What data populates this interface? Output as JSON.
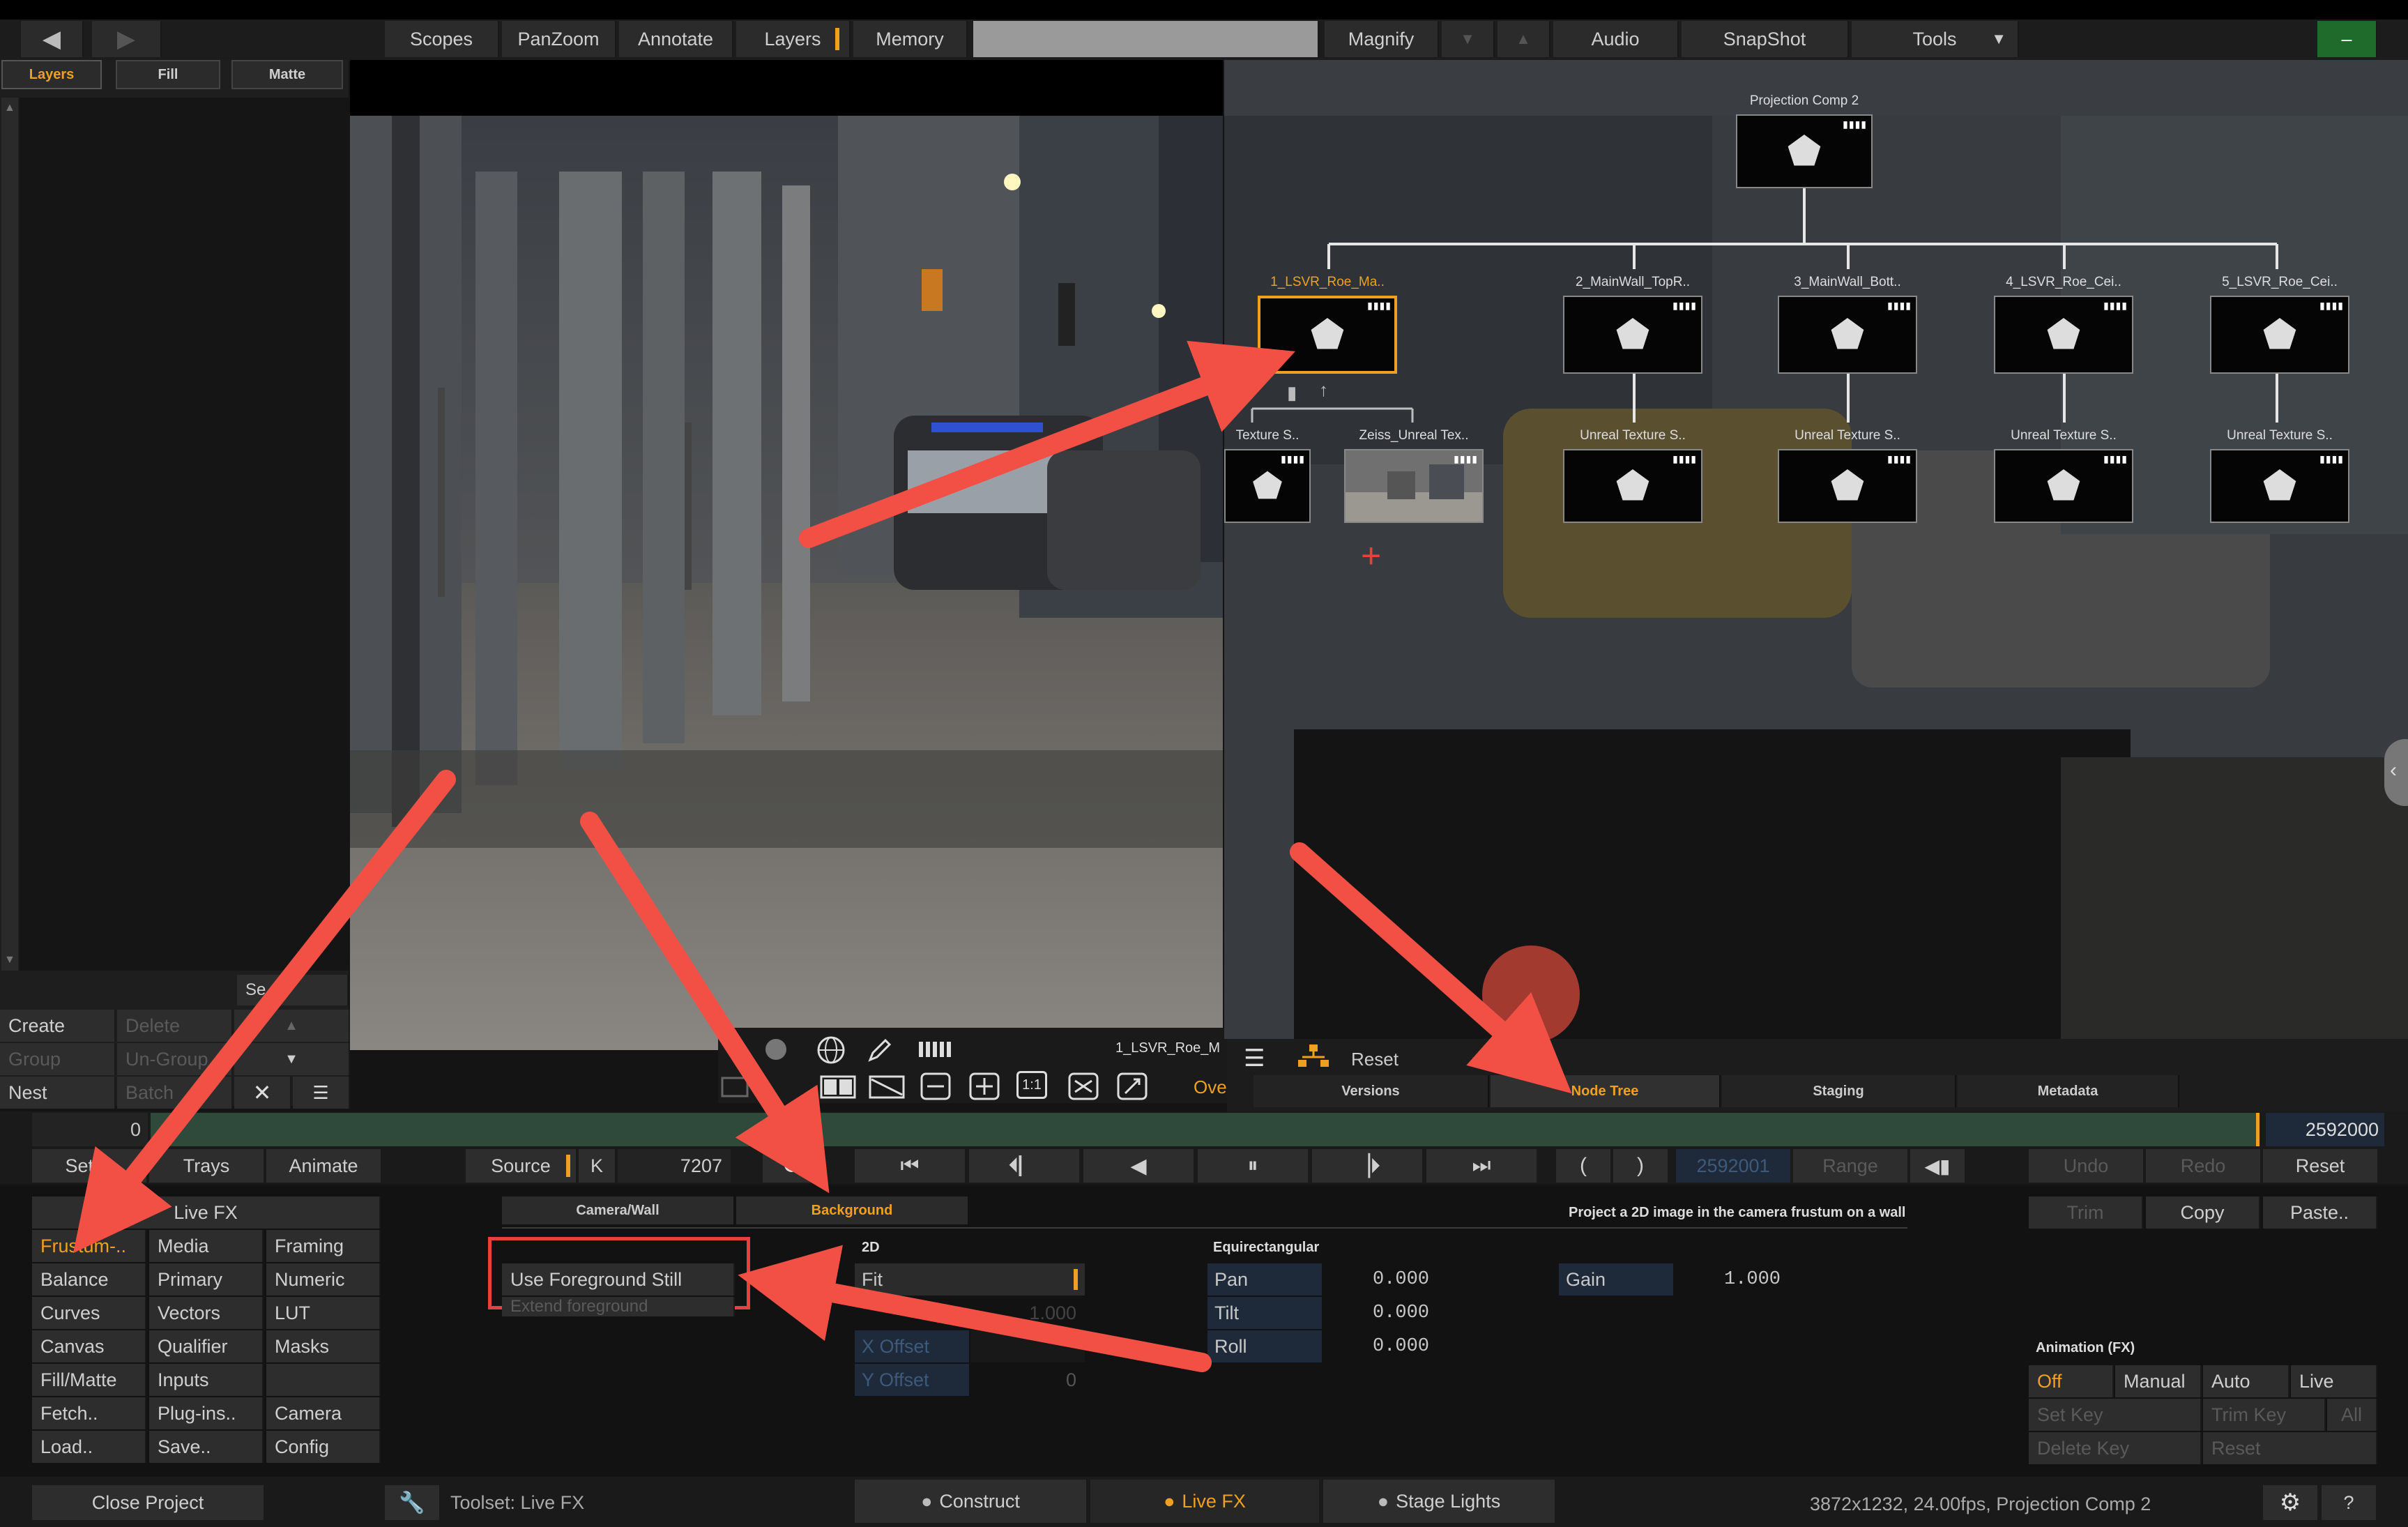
{
  "topbar": {
    "buttons": [
      "Scopes",
      "PanZoom",
      "Annotate",
      "Layers",
      "Memory",
      "Magnify",
      "Audio",
      "SnapShot",
      "Tools"
    ],
    "minimize": "–"
  },
  "left_panel": {
    "tabs": [
      "Layers",
      "Fill",
      "Matte"
    ],
    "partial_button": "Se",
    "rows": [
      [
        "Create",
        "Delete"
      ],
      [
        "Group",
        "Un-Group"
      ],
      [
        "Nest",
        "Batch"
      ]
    ]
  },
  "viewer": {
    "layer_label": "1_LSVR_Roe_M",
    "over_label": "Ove",
    "zoom_1to1": "1:1"
  },
  "node_tree": {
    "root": "Projection Comp 2",
    "top_row": [
      "1_LSVR_Roe_Ma..",
      "2_MainWall_TopR..",
      "3_MainWall_Bott..",
      "4_LSVR_Roe_Cei..",
      "5_LSVR_Roe_Cei.."
    ],
    "bottom_row": [
      "Texture S..",
      "Zeiss_Unreal Tex..",
      "Unreal Texture S..",
      "Unreal Texture S..",
      "Unreal Texture S..",
      "Unreal Texture S.."
    ]
  },
  "right_header": {
    "reset": "Reset",
    "tabs": [
      "Versions",
      "Node Tree",
      "Staging",
      "Metadata"
    ]
  },
  "timeline": {
    "start": "0",
    "end": "2592000"
  },
  "transport": {
    "left_tabs": [
      "Settin",
      "Trays",
      "Animate"
    ],
    "source_label": "Source",
    "k_label": "K",
    "frame": "7207",
    "duration": "2592001",
    "range": "Range",
    "undo": "Undo",
    "redo": "Redo",
    "reset": "Reset"
  },
  "livefx_menu": {
    "title": "Live FX",
    "rows": [
      [
        "Frustum-..",
        "Media",
        "Framing"
      ],
      [
        "Balance",
        "Primary",
        "Numeric"
      ],
      [
        "Curves",
        "Vectors",
        "LUT"
      ],
      [
        "Canvas",
        "Qualifier",
        "Masks"
      ],
      [
        "Fill/Matte",
        "Inputs",
        ""
      ],
      [
        "Fetch..",
        "Plug-ins..",
        "Camera"
      ],
      [
        "Load..",
        "Save..",
        "Config"
      ]
    ]
  },
  "fx_panel": {
    "tabs": [
      "Camera/Wall",
      "Background"
    ],
    "description": "Project a 2D image in the camera frustum on a wall",
    "use_foreground_still": "Use Foreground Still",
    "extend_foreground": "Extend foreground",
    "section_2d": "2D",
    "fit_label": "Fit",
    "fit_value": "1.000",
    "x_offset_label": "X Offset",
    "y_offset_label": "Y Offset",
    "y_offset_value": "0",
    "section_equirect": "Equirectangular",
    "pan_label": "Pan",
    "pan_value": "0.000",
    "tilt_label": "Tilt",
    "tilt_value": "0.000",
    "roll_label": "Roll",
    "roll_value": "0.000",
    "gain_label": "Gain",
    "gain_value": "1.000"
  },
  "right_tools": {
    "trim": "Trim",
    "copy": "Copy",
    "paste": "Paste..",
    "anim_title": "Animation (FX)",
    "anim_modes": [
      "Off",
      "Manual",
      "Auto",
      "Live"
    ],
    "set_key": "Set Key",
    "trim_key": "Trim Key",
    "all": "All",
    "delete_key": "Delete Key",
    "reset": "Reset"
  },
  "statusbar": {
    "close_project": "Close Project",
    "toolset": "Toolset: Live FX",
    "tabs": [
      "Construct",
      "Live FX",
      "Stage Lights"
    ],
    "info": "3872x1232, 24.00fps, Projection Comp 2",
    "help": "?"
  },
  "colors": {
    "accent": "#f0a020",
    "arrow": "#f25045",
    "callout": "#e8403a",
    "timeline_bar": "#2f4a3a"
  }
}
